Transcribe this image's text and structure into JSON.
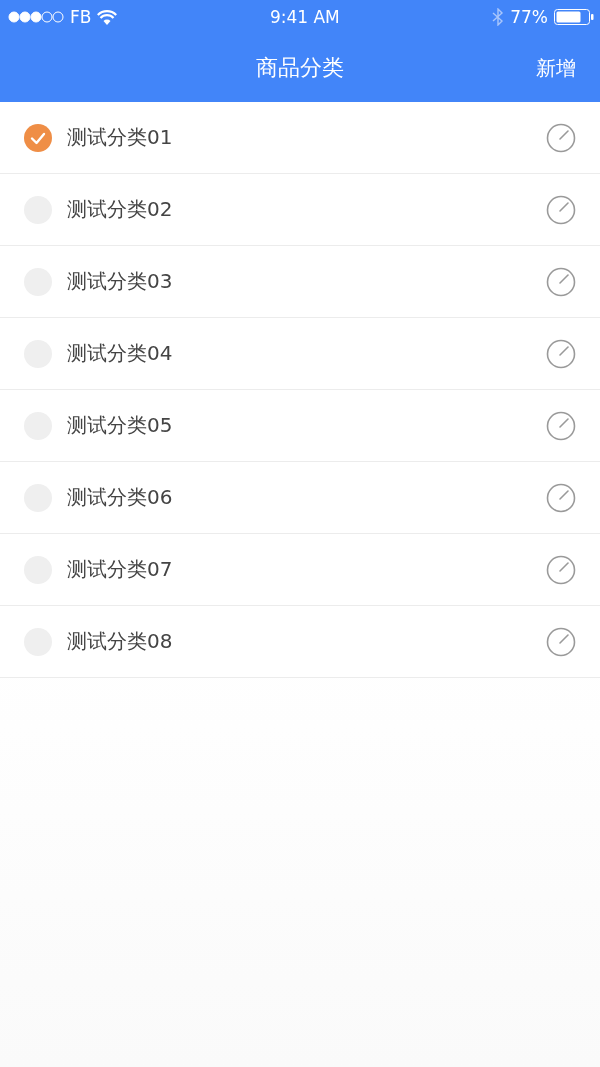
{
  "status_bar": {
    "carrier": "FB",
    "time": "9:41 AM",
    "battery": "77%"
  },
  "nav_bar": {
    "title": "商品分类",
    "action": "新增"
  },
  "categories": [
    {
      "name": "测试分类01",
      "selected": true
    },
    {
      "name": "测试分类02",
      "selected": false
    },
    {
      "name": "测试分类03",
      "selected": false
    },
    {
      "name": "测试分类04",
      "selected": false
    },
    {
      "name": "测试分类05",
      "selected": false
    },
    {
      "name": "测试分类06",
      "selected": false
    },
    {
      "name": "测试分类07",
      "selected": false
    },
    {
      "name": "测试分类08",
      "selected": false
    }
  ]
}
